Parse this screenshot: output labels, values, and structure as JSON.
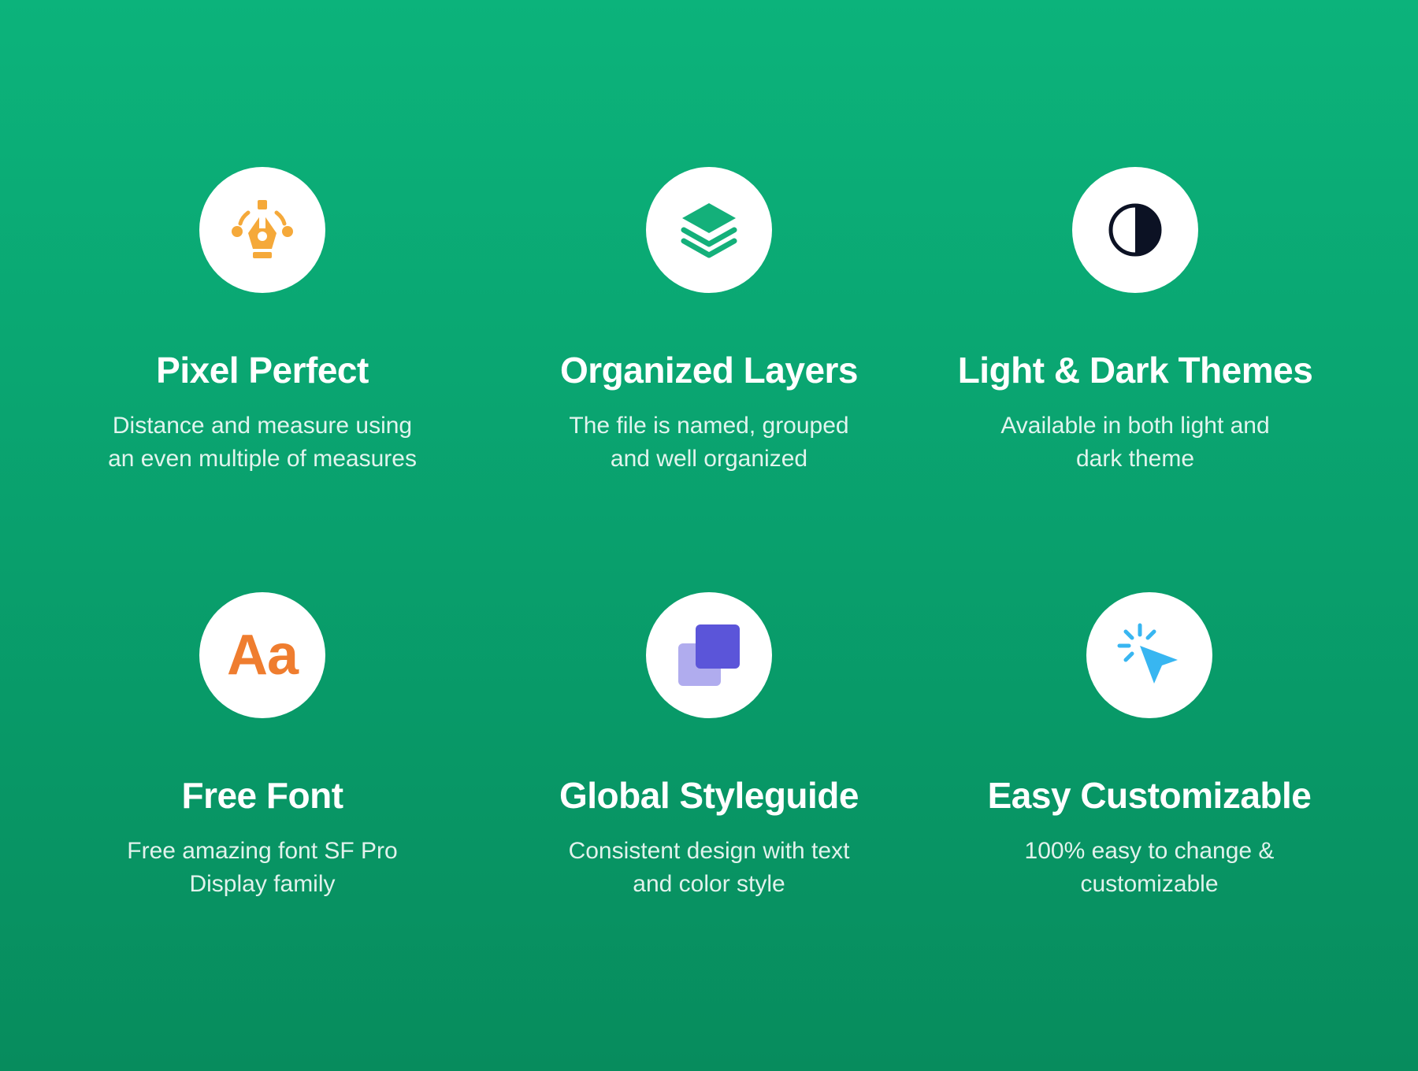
{
  "colors": {
    "background_top": "#0cb37b",
    "background_bottom": "#078c5d",
    "pen_icon": "#f5a93a",
    "layers_icon": "#14b07a",
    "theme_icon": "#0c1224",
    "font_icon": "#ef7d2f",
    "styleguide_front": "#5b55d9",
    "styleguide_back": "#b0acee",
    "cursor_icon": "#38b6f1"
  },
  "features": [
    {
      "icon": "pen-tool-icon",
      "title": "Pixel Perfect",
      "desc_line1": "Distance and measure using",
      "desc_line2": "an even multiple of measures"
    },
    {
      "icon": "layers-icon",
      "title": "Organized Layers",
      "desc_line1": "The file is named, grouped",
      "desc_line2": "and well organized"
    },
    {
      "icon": "contrast-icon",
      "title": "Light & Dark Themes",
      "desc_line1": "Available in both light and",
      "desc_line2": "dark theme"
    },
    {
      "icon": "font-icon",
      "icon_text": "Aa",
      "title": "Free Font",
      "desc_line1": "Free amazing font SF Pro",
      "desc_line2": "Display family"
    },
    {
      "icon": "styleguide-icon",
      "title": "Global Styleguide",
      "desc_line1": "Consistent design with text",
      "desc_line2": "and color style"
    },
    {
      "icon": "cursor-click-icon",
      "title": "Easy Customizable",
      "desc_line1": "100% easy to change &",
      "desc_line2": "customizable"
    }
  ]
}
